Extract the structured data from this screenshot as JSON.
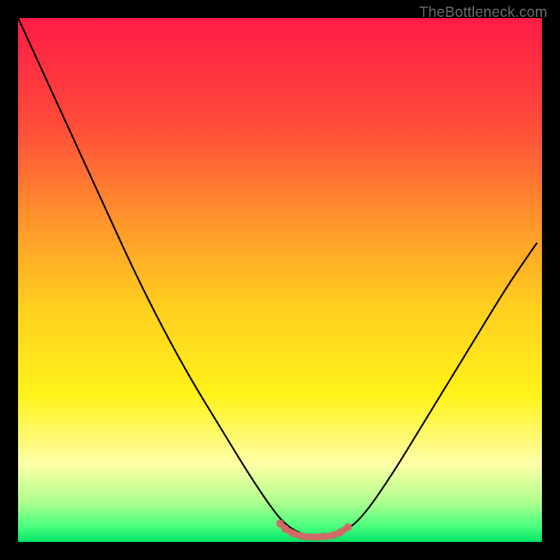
{
  "watermark": "TheBottleneck.com",
  "chart_data": {
    "type": "line",
    "title": "",
    "xlabel": "",
    "ylabel": "",
    "xlim": [
      0,
      100
    ],
    "ylim": [
      0,
      100
    ],
    "grid": false,
    "legend": false,
    "annotations": [],
    "background_gradient_stops": [
      {
        "pos": 0.0,
        "color": "#ff1c47"
      },
      {
        "pos": 0.2,
        "color": "#ff4a3a"
      },
      {
        "pos": 0.4,
        "color": "#ff9a2a"
      },
      {
        "pos": 0.55,
        "color": "#ffcf1f"
      },
      {
        "pos": 0.72,
        "color": "#fff31a"
      },
      {
        "pos": 0.85,
        "color": "#fdffa6"
      },
      {
        "pos": 0.92,
        "color": "#b4ff8f"
      },
      {
        "pos": 0.97,
        "color": "#4dff7e"
      },
      {
        "pos": 1.0,
        "color": "#00e566"
      }
    ],
    "series": [
      {
        "name": "bottleneck-curve",
        "color": "#000000",
        "x": [
          0.0,
          5.5,
          11.0,
          16.5,
          22.0,
          27.5,
          33.0,
          38.5,
          44.0,
          48.0,
          51.0,
          55.0,
          59.5,
          62.5,
          66.0,
          71.5,
          77.0,
          82.5,
          88.0,
          93.5,
          99.0
        ],
        "y": [
          100.0,
          88.0,
          76.0,
          64.0,
          52.0,
          41.0,
          31.0,
          22.0,
          13.0,
          7.0,
          3.2,
          1.0,
          1.0,
          2.0,
          5.0,
          13.0,
          22.0,
          31.0,
          40.0,
          49.0,
          57.0
        ]
      },
      {
        "name": "optimal-range-highlight",
        "color": "#cf6a66",
        "x": [
          50.0,
          51.0,
          52.5,
          54.0,
          55.5,
          57.0,
          58.5,
          60.0,
          61.5,
          63.0
        ],
        "y": [
          3.5,
          2.5,
          1.6,
          1.1,
          0.9,
          0.9,
          1.0,
          1.2,
          1.8,
          2.8
        ]
      }
    ]
  }
}
